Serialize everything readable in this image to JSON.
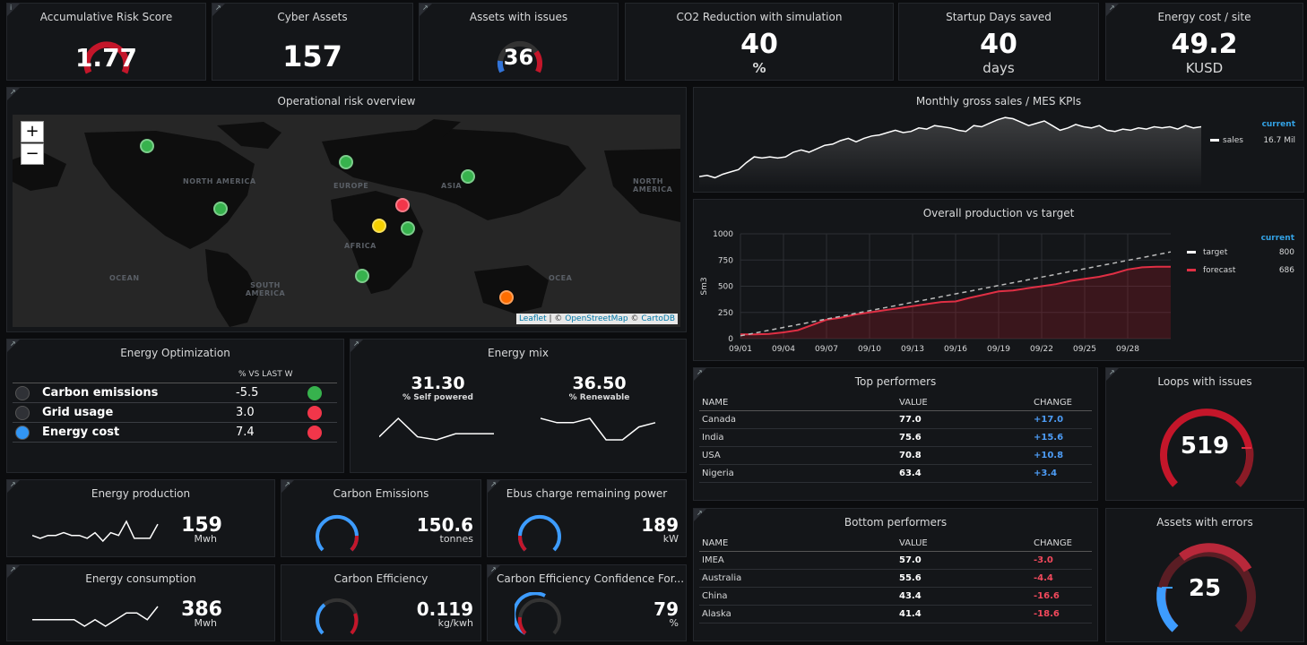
{
  "stats": {
    "risk": {
      "title": "Accumulative Risk Score",
      "value": "1.77"
    },
    "cyber": {
      "title": "Cyber Assets",
      "value": "157"
    },
    "issues": {
      "title": "Assets with issues",
      "value": "36"
    },
    "co2": {
      "title": "CO2 Reduction with simulation",
      "value": "40",
      "unit": "%"
    },
    "startup": {
      "title": "Startup Days saved",
      "value": "40",
      "unit": "days"
    },
    "energycost": {
      "title": "Energy cost / site",
      "value": "49.2",
      "unit": "KUSD"
    }
  },
  "map": {
    "title": "Operational risk overview",
    "zoom_in": "+",
    "zoom_out": "−",
    "labels": [
      "NORTH AMERICA",
      "EUROPE",
      "ASIA",
      "AFRICA",
      "SOUTH AMERICA",
      "OCEAN",
      "OCEA",
      "NORTH AMERICA"
    ],
    "attribution": {
      "leaflet": "Leaflet",
      "sep1": " | © ",
      "osm": "OpenStreetMap",
      "sep2": " © ",
      "carto": "CartoDB"
    },
    "markers": [
      {
        "name": "alaska",
        "color": "#37b24d"
      },
      {
        "name": "usa",
        "color": "#37b24d"
      },
      {
        "name": "europe",
        "color": "#37b24d"
      },
      {
        "name": "middle-east",
        "color": "#f2364a"
      },
      {
        "name": "africa-north",
        "color": "#f5d000"
      },
      {
        "name": "africa-east",
        "color": "#37b24d"
      },
      {
        "name": "asia",
        "color": "#37b24d"
      },
      {
        "name": "africa-south",
        "color": "#37b24d"
      },
      {
        "name": "australia",
        "color": "#ff6d00"
      }
    ]
  },
  "sales": {
    "title": "Monthly gross sales / MES KPIs",
    "legend_head": "current",
    "series_name": "sales",
    "series_value": "16.7 Mil",
    "values": [
      10,
      11,
      9,
      12,
      14,
      16,
      22,
      27,
      26,
      27,
      26,
      27,
      31,
      33,
      31,
      34,
      37,
      38,
      41,
      43,
      40,
      43,
      45,
      46,
      48,
      50,
      48,
      49,
      52,
      51,
      54,
      53,
      52,
      50,
      49,
      54,
      53,
      56,
      59,
      61,
      60,
      57,
      54,
      56,
      58,
      54,
      50,
      52,
      55,
      53,
      52,
      54,
      50,
      49,
      51,
      50,
      52,
      51,
      53,
      52,
      53,
      51,
      54,
      52,
      53
    ]
  },
  "production": {
    "title": "Overall production vs target",
    "ylabel": "Sm3",
    "legend_head": "current",
    "target_name": "target",
    "target_value": "800",
    "forecast_name": "forecast",
    "forecast_value": "686",
    "chart_data": {
      "type": "line",
      "x": [
        "09/01",
        "09/02",
        "09/03",
        "09/04",
        "09/05",
        "09/06",
        "09/07",
        "09/08",
        "09/09",
        "09/10",
        "09/11",
        "09/12",
        "09/13",
        "09/14",
        "09/15",
        "09/16",
        "09/17",
        "09/18",
        "09/19",
        "09/20",
        "09/21",
        "09/22",
        "09/23",
        "09/24",
        "09/25",
        "09/26",
        "09/27",
        "09/28",
        "09/29",
        "09/30",
        "10/01"
      ],
      "xticks": [
        "09/01",
        "09/04",
        "09/07",
        "09/10",
        "09/13",
        "09/16",
        "09/19",
        "09/22",
        "09/25",
        "09/28"
      ],
      "yticks": [
        0,
        250,
        500,
        750,
        1000
      ],
      "ylim": [
        0,
        1000
      ],
      "series": [
        {
          "name": "target",
          "values": [
            27,
            53,
            80,
            107,
            133,
            160,
            187,
            213,
            240,
            267,
            293,
            320,
            347,
            373,
            400,
            427,
            453,
            480,
            507,
            533,
            560,
            587,
            613,
            640,
            667,
            693,
            720,
            747,
            773,
            800,
            827
          ]
        },
        {
          "name": "forecast",
          "values": [
            40,
            40,
            45,
            60,
            80,
            130,
            180,
            200,
            230,
            250,
            270,
            290,
            310,
            330,
            350,
            355,
            390,
            420,
            450,
            460,
            480,
            500,
            520,
            550,
            570,
            590,
            620,
            660,
            680,
            686,
            686
          ]
        }
      ]
    }
  },
  "energy_opt": {
    "title": "Energy Optimization",
    "col_header": "% VS LAST W",
    "rows": [
      {
        "label": "Carbon emissions",
        "value": "-5.5",
        "lead": "#2f3136",
        "dot": "#37b24d"
      },
      {
        "label": "Grid usage",
        "value": "3.0",
        "lead": "#2f3136",
        "dot": "#f2364a"
      },
      {
        "label": "Energy cost",
        "value": "7.4",
        "lead": "#3296f5",
        "dot": "#f2364a"
      }
    ]
  },
  "energy_mix": {
    "title": "Energy mix",
    "self_value": "31.30",
    "self_label": "% Self powered",
    "renew_value": "36.50",
    "renew_label": "% Renewable",
    "self_spark": [
      3,
      9,
      3,
      2,
      4,
      4,
      4
    ],
    "renew_spark": [
      8,
      7,
      7,
      8,
      3,
      3,
      6,
      7
    ]
  },
  "top": {
    "title": "Top performers",
    "headers": [
      "NAME",
      "VALUE",
      "CHANGE"
    ],
    "rows": [
      {
        "name": "Canada",
        "value": "77.0",
        "change": "+17.0"
      },
      {
        "name": "India",
        "value": "75.6",
        "change": "+15.6"
      },
      {
        "name": "USA",
        "value": "70.8",
        "change": "+10.8"
      },
      {
        "name": "Nigeria",
        "value": "63.4",
        "change": "+3.4"
      }
    ]
  },
  "bottom": {
    "title": "Bottom performers",
    "headers": [
      "NAME",
      "VALUE",
      "CHANGE"
    ],
    "rows": [
      {
        "name": "IMEA",
        "value": "57.0",
        "change": "-3.0"
      },
      {
        "name": "Australia",
        "value": "55.6",
        "change": "-4.4"
      },
      {
        "name": "China",
        "value": "43.4",
        "change": "-16.6"
      },
      {
        "name": "Alaska",
        "value": "41.4",
        "change": "-18.6"
      }
    ]
  },
  "loops": {
    "title": "Loops with issues",
    "value": "519"
  },
  "asset_errors": {
    "title": "Assets with errors",
    "value": "25"
  },
  "eprod": {
    "title": "Energy production",
    "value": "159",
    "unit": "Mwh",
    "spark": [
      4,
      3,
      4,
      4,
      5,
      4,
      4,
      3,
      5,
      2,
      5,
      4,
      9,
      3,
      3,
      3,
      8
    ]
  },
  "econs": {
    "title": "Energy consumption",
    "value": "386",
    "unit": "Mwh",
    "spark": [
      4,
      4,
      4,
      4,
      4,
      3,
      4,
      3,
      4,
      5,
      5,
      4,
      6
    ]
  },
  "cemis": {
    "title": "Carbon Emissions",
    "value": "150.6",
    "unit": "tonnes"
  },
  "ceff": {
    "title": "Carbon Efficiency",
    "value": "0.119",
    "unit": "kg/kwh"
  },
  "ebus": {
    "title": "Ebus charge remaining power",
    "value": "189",
    "unit": "kW"
  },
  "cefc": {
    "title": "Carbon Efficiency Confidence For...",
    "value": "79",
    "unit": "%"
  }
}
